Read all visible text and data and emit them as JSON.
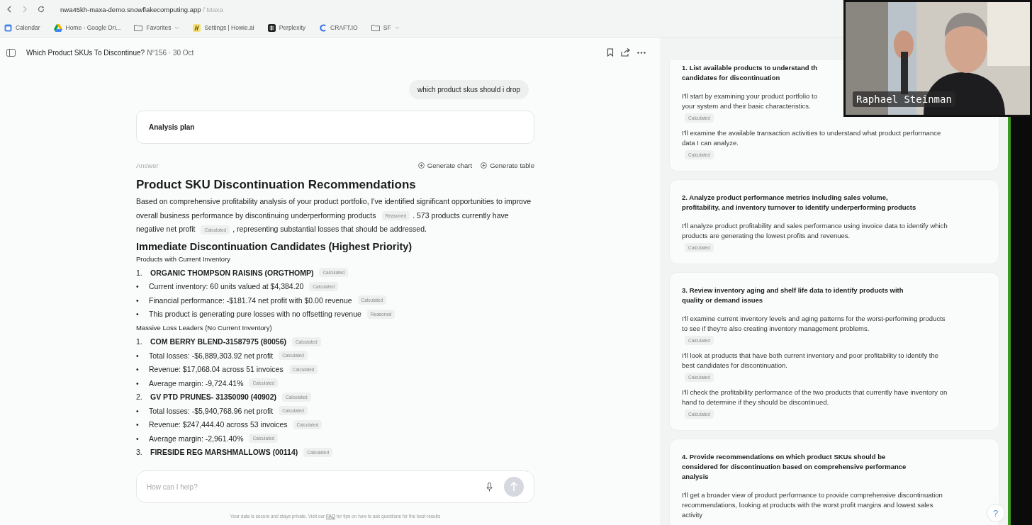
{
  "browser": {
    "url": "nwa45kh-maxa-demo.snowflakecomputing.app",
    "site": "/ Maxa",
    "bookmarks": [
      {
        "label": "Calendar",
        "kind": "calendar"
      },
      {
        "label": "Home - Google Dri...",
        "kind": "drive"
      },
      {
        "label": "Favorites",
        "kind": "folder"
      },
      {
        "label": "Settings | Howie.ai",
        "kind": "howie"
      },
      {
        "label": "Perplexity",
        "kind": "perplexity"
      },
      {
        "label": "CRAFT.IO",
        "kind": "craft"
      },
      {
        "label": "SF",
        "kind": "folder"
      }
    ]
  },
  "conversation": {
    "title": "Which Product SKUs To Discontinue?",
    "meta": "N°156 · 30 Oct",
    "user_message": "which product skus should i drop",
    "analysis_plan": "Analysis plan",
    "answer_label": "Answer",
    "actions": [
      "Generate chart",
      "Generate table"
    ],
    "heading": "Product SKU Discontinuation Recommendations",
    "intro": [
      {
        "kind": "text",
        "text": "Based on comprehensive profitability analysis of your product portfolio, I've identified significant opportunities to improve overall business performance by discontinuing underperforming products"
      },
      {
        "kind": "badge",
        "text": "Reasoned"
      },
      {
        "kind": "text",
        "text": ". 573 products currently have negative net profit"
      },
      {
        "kind": "badge",
        "text": "Calculated"
      },
      {
        "kind": "text",
        "text": ", representing substantial losses that should be addressed."
      }
    ],
    "subheading": "Immediate Discontinuation Candidates (Highest Priority)",
    "items": [
      {
        "kind": "label",
        "text": "Products with Current Inventory"
      },
      {
        "kind": "numbered",
        "marker": "1.",
        "text": "ORGANIC THOMPSON RAISINS (ORGTHOMP)",
        "badge": "Calculated"
      },
      {
        "kind": "bullet",
        "marker": "•",
        "text": "Current inventory: 60 units valued at $4,384.20",
        "badge": "Calculated"
      },
      {
        "kind": "bullet",
        "marker": "•",
        "text": "Financial performance: -$181.74 net profit with $0.00 revenue",
        "badge": "Calculated"
      },
      {
        "kind": "bullet",
        "marker": "•",
        "text": "This product is generating pure losses with no offsetting revenue",
        "badge": "Reasoned"
      },
      {
        "kind": "label",
        "text": "Massive Loss Leaders (No Current Inventory)"
      },
      {
        "kind": "numbered",
        "marker": "1.",
        "text": "COM BERRY BLEND-31587975 (80056)",
        "badge": "Calculated"
      },
      {
        "kind": "bullet",
        "marker": "•",
        "text": "Total losses: -$6,889,303.92 net profit",
        "badge": "Calculated"
      },
      {
        "kind": "bullet",
        "marker": "•",
        "text": "Revenue: $17,068.04 across 51 invoices",
        "badge": "Calculated"
      },
      {
        "kind": "bullet",
        "marker": "•",
        "text": "Average margin: -9,724.41%",
        "badge": "Calculated"
      },
      {
        "kind": "numbered",
        "marker": "2.",
        "text": "GV PTD PRUNES- 31350090 (40902)",
        "badge": "Calculated"
      },
      {
        "kind": "bullet",
        "marker": "•",
        "text": "Total losses: -$5,940,768.96 net profit",
        "badge": "Calculated"
      },
      {
        "kind": "bullet",
        "marker": "•",
        "text": "Revenue: $247,444.40 across 53 invoices",
        "badge": "Calculated"
      },
      {
        "kind": "bullet",
        "marker": "•",
        "text": "Average margin: -2,961.40%",
        "badge": "Calculated"
      },
      {
        "kind": "numbered",
        "marker": "3.",
        "text": "FIRESIDE REG MARSHMALLOWS (00114)",
        "badge": "Calculated"
      }
    ]
  },
  "composer": {
    "placeholder": "How can I help?"
  },
  "footer": {
    "before": "Your data is secure and stays private. Visit our",
    "link": "FAQ",
    "after": "for tips on how to ask questions for the best results"
  },
  "plan": {
    "steps": [
      {
        "title_lines": [
          "1. List available products to understand th",
          "candidates for discontinuation"
        ],
        "notes": [
          {
            "lines": [
              "I'll start by examining your product portfolio to",
              "your system and their basic characteristics."
            ],
            "badge": "Calculated"
          },
          {
            "lines": [
              "I'll examine the available transaction activities to understand what product performance",
              "data I can analyze."
            ],
            "badge": "Calculated"
          }
        ]
      },
      {
        "title_lines": [
          "2. Analyze product performance metrics including sales volume,",
          "profitability, and inventory turnover to identify underperforming products"
        ],
        "notes": [
          {
            "lines": [
              "I'll analyze product profitability and sales performance using invoice data to identify which",
              "products are generating the lowest profits and revenues."
            ],
            "badge": "Calculated"
          }
        ]
      },
      {
        "title_lines": [
          "3. Review inventory aging and shelf life data to identify products with",
          "quality or demand issues"
        ],
        "notes": [
          {
            "lines": [
              "I'll examine current inventory levels and aging patterns for the worst-performing products",
              "to see if they're also creating inventory management problems."
            ],
            "badge": "Calculated"
          },
          {
            "lines": [
              "I'll look at products that have both current inventory and poor profitability to identify the",
              "best candidates for discontinuation."
            ],
            "badge": "Calculated"
          },
          {
            "lines": [
              "I'll check the profitability performance of the two products that currently have inventory on",
              "hand to determine if they should be discontinued."
            ],
            "badge": "Calculated"
          }
        ]
      },
      {
        "title_lines": [
          "4. Provide recommendations on which product SKUs should be",
          "considered for discontinuation based on comprehensive performance",
          "analysis"
        ],
        "notes": [
          {
            "lines": [
              "I'll get a broader view of product performance to provide comprehensive discontinuation",
              "recommendations, looking at products with the worst profit margins and lowest sales",
              "activity"
            ]
          }
        ]
      }
    ],
    "help": "?"
  },
  "video": {
    "name": "Raphael Steinman"
  }
}
